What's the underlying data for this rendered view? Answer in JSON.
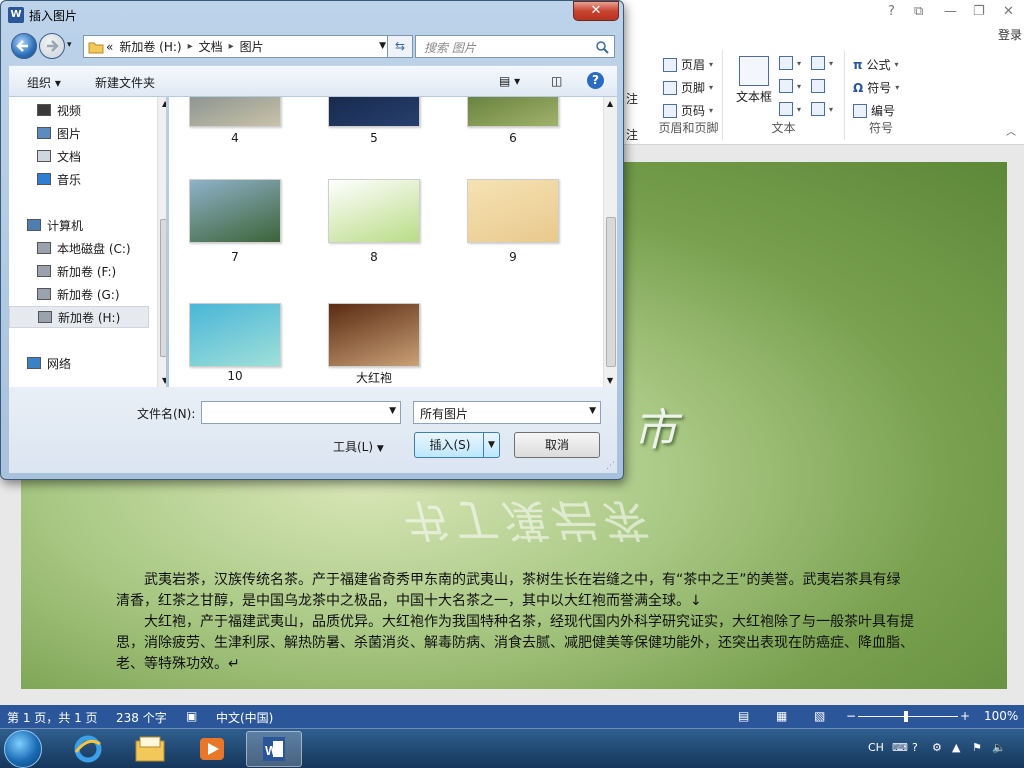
{
  "word": {
    "title_controls": [
      "?",
      "⧉",
      "—",
      "❐",
      "✕"
    ],
    "login": "登录",
    "ribbon": {
      "partial_top": "注",
      "partial_bottom": "注",
      "header_footer": {
        "items": [
          "页眉",
          "页脚",
          "页码"
        ],
        "label": "页眉和页脚"
      },
      "text": {
        "textbox": "文本框",
        "label": "文本"
      },
      "symbols": {
        "items": [
          "公式",
          "符号",
          "编号"
        ],
        "label": "符号"
      }
    },
    "document": {
      "title_char": "市",
      "reflection": "书丁漢岩茶",
      "paragraphs": [
        "武夷岩茶，汉族传统名茶。产于福建省奇秀甲东南的武夷山，茶树生长在岩缝之中，有“茶中之王”的美誉。武夷岩茶具有绿",
        "清香，红茶之甘醇，是中国乌龙茶中之极品，中国十大名茶之一，其中以大红袍而誉满全球。↓",
        "大红袍，产于福建武夷山，品质优异。大红袍作为我国特种名茶，经现代国内外科学研究证实，大红袍除了与一般茶叶具有提",
        "思，消除疲劳、生津利尿、解热防暑、杀菌消炎、解毒防病、消食去腻、减肥健美等保健功能外，还突出表现在防癌症、降血脂、",
        "老、等特殊功效。↵"
      ]
    },
    "status": {
      "page": "第 1 页，共 1 页",
      "words": "238 个字",
      "language": "中文(中国)",
      "zoom": "100%"
    }
  },
  "dialog": {
    "title": "插入图片",
    "address": {
      "prefix": "«",
      "segments": [
        "新加卷 (H:)",
        "文档",
        "图片"
      ]
    },
    "search_placeholder": "搜索 图片",
    "commands": {
      "organize": "组织 ▾",
      "new_folder": "新建文件夹"
    },
    "nav_items": [
      {
        "label": "视频",
        "icon": "video-icon"
      },
      {
        "label": "图片",
        "icon": "pictures-icon"
      },
      {
        "label": "文档",
        "icon": "documents-icon"
      },
      {
        "label": "音乐",
        "icon": "music-icon"
      },
      {
        "label": "计算机",
        "icon": "computer-icon"
      },
      {
        "label": "本地磁盘 (C:)",
        "icon": "drive-icon"
      },
      {
        "label": "新加卷 (F:)",
        "icon": "drive-icon"
      },
      {
        "label": "新加卷 (G:)",
        "icon": "drive-icon"
      },
      {
        "label": "新加卷 (H:)",
        "icon": "drive-icon",
        "selected": true
      },
      {
        "label": "网络",
        "icon": "network-icon"
      }
    ],
    "files": [
      {
        "name": "4",
        "colors": [
          "#6f7f86",
          "#c8c2a8"
        ]
      },
      {
        "name": "5",
        "colors": [
          "#0f1e3a",
          "#27406d"
        ]
      },
      {
        "name": "6",
        "colors": [
          "#4d6a2a",
          "#9fb26a"
        ]
      },
      {
        "name": "7",
        "colors": [
          "#8fb2c9",
          "#3c6438"
        ]
      },
      {
        "name": "8",
        "colors": [
          "#ffffff",
          "#b9dc86"
        ]
      },
      {
        "name": "9",
        "colors": [
          "#f5e2b4",
          "#e9c98d"
        ]
      },
      {
        "name": "10",
        "colors": [
          "#4ab6d8",
          "#9fe0d8"
        ]
      },
      {
        "name": "大红袍",
        "colors": [
          "#5a2a12",
          "#c9a277"
        ]
      }
    ],
    "filename_label": "文件名(N):",
    "filename_value": "",
    "filter": "所有图片",
    "tools": "工具(L)",
    "insert": "插入(S)",
    "cancel": "取消"
  },
  "taskbar": {
    "apps": [
      "ie-icon",
      "explorer-icon",
      "media-player-icon",
      "word-icon"
    ],
    "tray": {
      "lang": "CH"
    }
  }
}
